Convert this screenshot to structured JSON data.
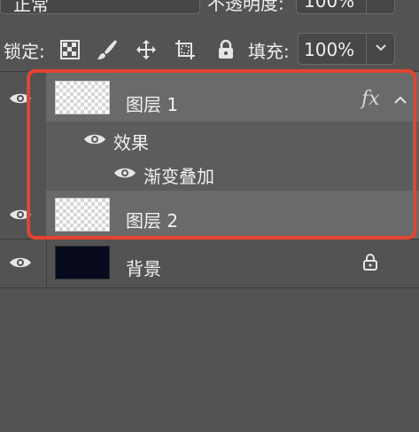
{
  "top_row": {
    "blend_mode": "正常",
    "opacity_label": "不透明度:",
    "opacity_value": "100%"
  },
  "lock_row": {
    "label": "锁定:",
    "icons": [
      "lock-transparent-pixels-icon",
      "lock-image-pixels-icon",
      "lock-position-icon",
      "lock-artboard-icon",
      "lock-all-icon"
    ],
    "fill_label": "填充:",
    "fill_value": "100%"
  },
  "layers": [
    {
      "name": "图层 1",
      "thumb": "transparent",
      "has_fx": true,
      "fx_label": "fx",
      "selected": true
    },
    {
      "effects_label": "效果",
      "effect_items": [
        "渐变叠加"
      ]
    },
    {
      "name": "图层 2",
      "thumb": "transparent",
      "selected": true
    },
    {
      "name": "背景",
      "thumb": "dark",
      "locked": true
    }
  ],
  "colors": {
    "panel_bg": "#535353",
    "selected_row_bg": "#6a6a6a",
    "highlight_border": "#e5432f",
    "background_thumb": "#070b1d"
  }
}
